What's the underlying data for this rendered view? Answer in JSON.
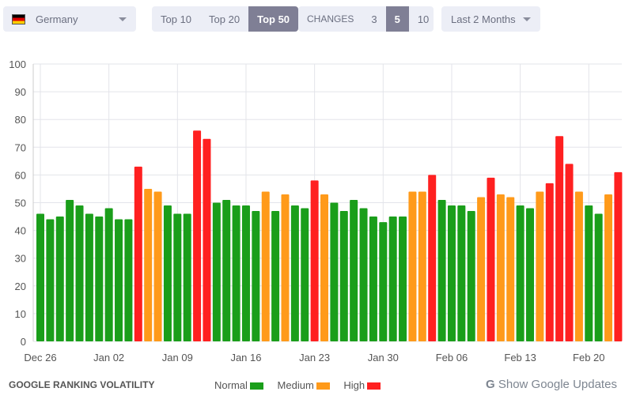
{
  "filters": {
    "country": {
      "value": "Germany",
      "icon": "germany-flag-icon"
    },
    "top": {
      "options": [
        "Top 10",
        "Top 20",
        "Top 50"
      ],
      "selected": "Top 50"
    },
    "changes": {
      "label": "CHANGES",
      "options": [
        "3",
        "5",
        "10"
      ],
      "selected": "5"
    },
    "period": {
      "value": "Last 2 Months"
    }
  },
  "footer": {
    "title": "GOOGLE RANKING VOLATILITY",
    "legend": [
      {
        "label": "Normal",
        "color": "#1a9e1a"
      },
      {
        "label": "Medium",
        "color": "#ff9a1a"
      },
      {
        "label": "High",
        "color": "#ff2020"
      }
    ],
    "updates_link": "Show Google Updates",
    "updates_icon": "google-g-icon"
  },
  "chart_data": {
    "type": "bar",
    "ylim": [
      0,
      100
    ],
    "yticks": [
      0,
      10,
      20,
      30,
      40,
      50,
      60,
      70,
      80,
      90,
      100
    ],
    "grid": true,
    "xticks": [
      "Dec 26",
      "Jan 02",
      "Jan 09",
      "Jan 16",
      "Jan 23",
      "Jan 30",
      "Feb 06",
      "Feb 13",
      "Feb 20"
    ],
    "first_date": "Dec 26",
    "values": [
      46,
      44,
      45,
      51,
      49,
      46,
      45,
      48,
      44,
      44,
      63,
      55,
      54,
      49,
      46,
      46,
      76,
      73,
      50,
      51,
      49,
      49,
      47,
      54,
      47,
      53,
      49,
      48,
      58,
      53,
      50,
      47,
      51,
      48,
      45,
      43,
      45,
      45,
      54,
      54,
      60,
      51,
      49,
      49,
      47,
      52,
      59,
      53,
      52,
      49,
      48,
      54,
      57,
      74,
      64,
      54,
      49,
      46,
      53,
      61
    ],
    "levels": [
      "normal",
      "normal",
      "normal",
      "normal",
      "normal",
      "normal",
      "normal",
      "normal",
      "normal",
      "normal",
      "high",
      "medium",
      "medium",
      "normal",
      "normal",
      "normal",
      "high",
      "high",
      "normal",
      "normal",
      "normal",
      "normal",
      "normal",
      "medium",
      "normal",
      "medium",
      "normal",
      "normal",
      "high",
      "medium",
      "normal",
      "normal",
      "normal",
      "normal",
      "normal",
      "normal",
      "normal",
      "normal",
      "medium",
      "medium",
      "high",
      "normal",
      "normal",
      "normal",
      "normal",
      "medium",
      "high",
      "medium",
      "medium",
      "normal",
      "normal",
      "medium",
      "high",
      "high",
      "high",
      "medium",
      "normal",
      "normal",
      "medium",
      "high"
    ],
    "colors": {
      "normal": "#1a9e1a",
      "medium": "#ff9a1a",
      "high": "#ff2020"
    }
  }
}
